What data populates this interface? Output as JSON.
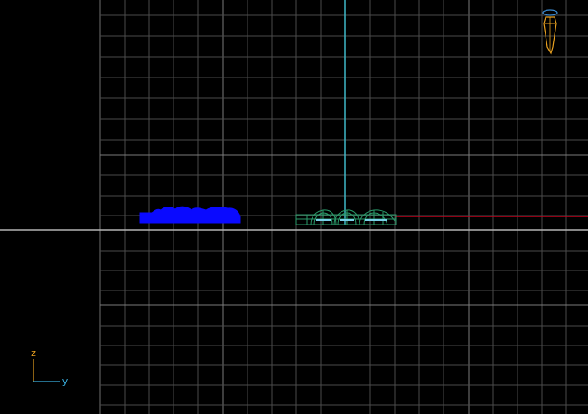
{
  "viewport": {
    "background": "#000000",
    "grid_color": "#5a5a5a",
    "grid_major_color": "#8a8a8a",
    "horizon_color": "#b4b4b4",
    "vertical_axis_color": "#3fb8c8",
    "horizontal_axis_color": "#c0001a",
    "blue_object_color": "#0a0aff",
    "green_object_color": "#2a9a6a",
    "green_object_highlight": "#7ad0e8"
  },
  "axis_gizmo": {
    "vertical_label": "z",
    "horizontal_label": "y",
    "vertical_color": "#e8a020",
    "horizontal_color": "#3ab0e0"
  },
  "camera_icon": {
    "name": "camera-marker-icon",
    "body_color": "#e8a020",
    "ring_color": "#3a8ad0"
  }
}
